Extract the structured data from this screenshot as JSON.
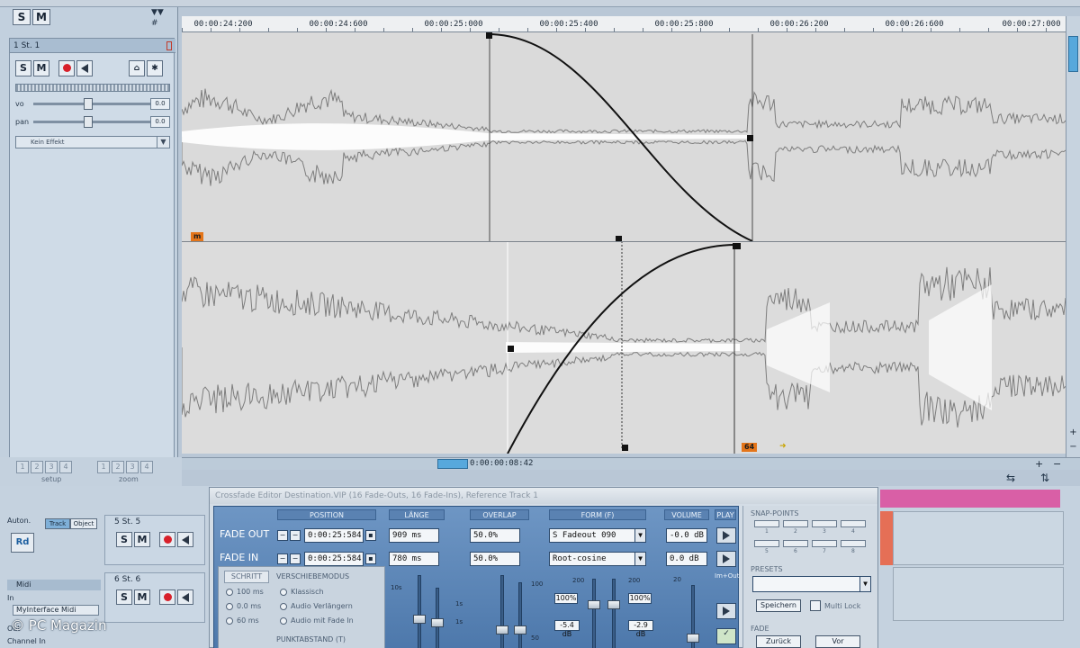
{
  "ruler": {
    "labels": [
      "00:00:24:200",
      "00:00:24:600",
      "00:00:25:000",
      "00:00:25:400",
      "00:00:25:800",
      "00:00:26:200",
      "00:00:26:600",
      "00:00:27:000"
    ]
  },
  "top_left": {
    "solo_label": "S",
    "mute_label": "M"
  },
  "track": {
    "header": "1    St. 1",
    "solo_label": "S",
    "mute_label": "M",
    "vol_label": "vo",
    "vol_value": "0.0",
    "pan_label": "pan",
    "pan_value": "0.0",
    "plugin": "Kein Effekt"
  },
  "editor": {
    "upper_marker": "m",
    "lower_marker": "64",
    "time_position": "0:00:00:08:42"
  },
  "lower_left": {
    "setup_caption": "setup",
    "zoom_caption": "zoom",
    "buttons": [
      "1",
      "2",
      "3",
      "4"
    ],
    "auto_label": "Auton.",
    "track_label": "Track",
    "object_label": "Object",
    "rd_label": "Rd",
    "midi_label": "Midi",
    "in_label": "In",
    "interface": "MyInterface Midi",
    "out_label": "Out",
    "channel_label": "Channel In"
  },
  "tracks_lower": [
    {
      "title": "5    St. 5",
      "solo": "S",
      "mute": "M"
    },
    {
      "title": "6    St. 6",
      "solo": "S",
      "mute": "M"
    }
  ],
  "crossfade": {
    "title": "Crossfade Editor Destination.VIP (16 Fade-Outs, 16 Fade-Ins), Reference Track 1",
    "headers": {
      "position": "POSITION",
      "laenge": "LÄNGE",
      "overlap": "OVERLAP",
      "form": "FORM (F)",
      "volume": "VOLUME",
      "play": "PLAY"
    },
    "fade_out": {
      "label": "FADE OUT",
      "position": "0:00:25:584",
      "laenge": "909 ms",
      "overlap": "50.0%",
      "form": "S Fadeout 090",
      "volume": "-0.0 dB"
    },
    "fade_in": {
      "label": "FADE IN",
      "position": "0:00:25:584",
      "laenge": "780 ms",
      "overlap": "50.0%",
      "form": "Root-cosine",
      "volume": "0.0 dB"
    },
    "schritt": {
      "label": "SCHRITT",
      "options": [
        "100 ms",
        "0.0 ms",
        "60 ms"
      ]
    },
    "verschiebemodus": {
      "label": "VERSCHIEBEMODUS",
      "options": [
        "Klassisch",
        "Audio Verlängern",
        "Audio mit Fade In"
      ]
    },
    "punktabstand_label": "PUNKTABSTAND (T)",
    "scales": {
      "len_top": "10s",
      "len_mid": "1s",
      "len_low": "1s",
      "overlap_top": "100",
      "overlap_low": "50",
      "form_top": "200",
      "form_top2": "200",
      "vol_top": "20"
    },
    "form_pct_1": "100%",
    "form_pct_2": "100%",
    "form_db_1": "-5.4 dB",
    "form_db_2": "-2.9 dB",
    "crossfade_label": "Im+Out",
    "snap_label": "SNAP-POINTS",
    "snap_nums": [
      "1",
      "2",
      "3",
      "4",
      "5",
      "6",
      "7",
      "8"
    ],
    "presets_label": "PRESETS",
    "save_label": "Speichern",
    "multi_label": "Multi Lock",
    "fade_label": "FADE",
    "back_label": "Zurück",
    "forward_label": "Vor"
  },
  "watermark": "© PC Magazin"
}
